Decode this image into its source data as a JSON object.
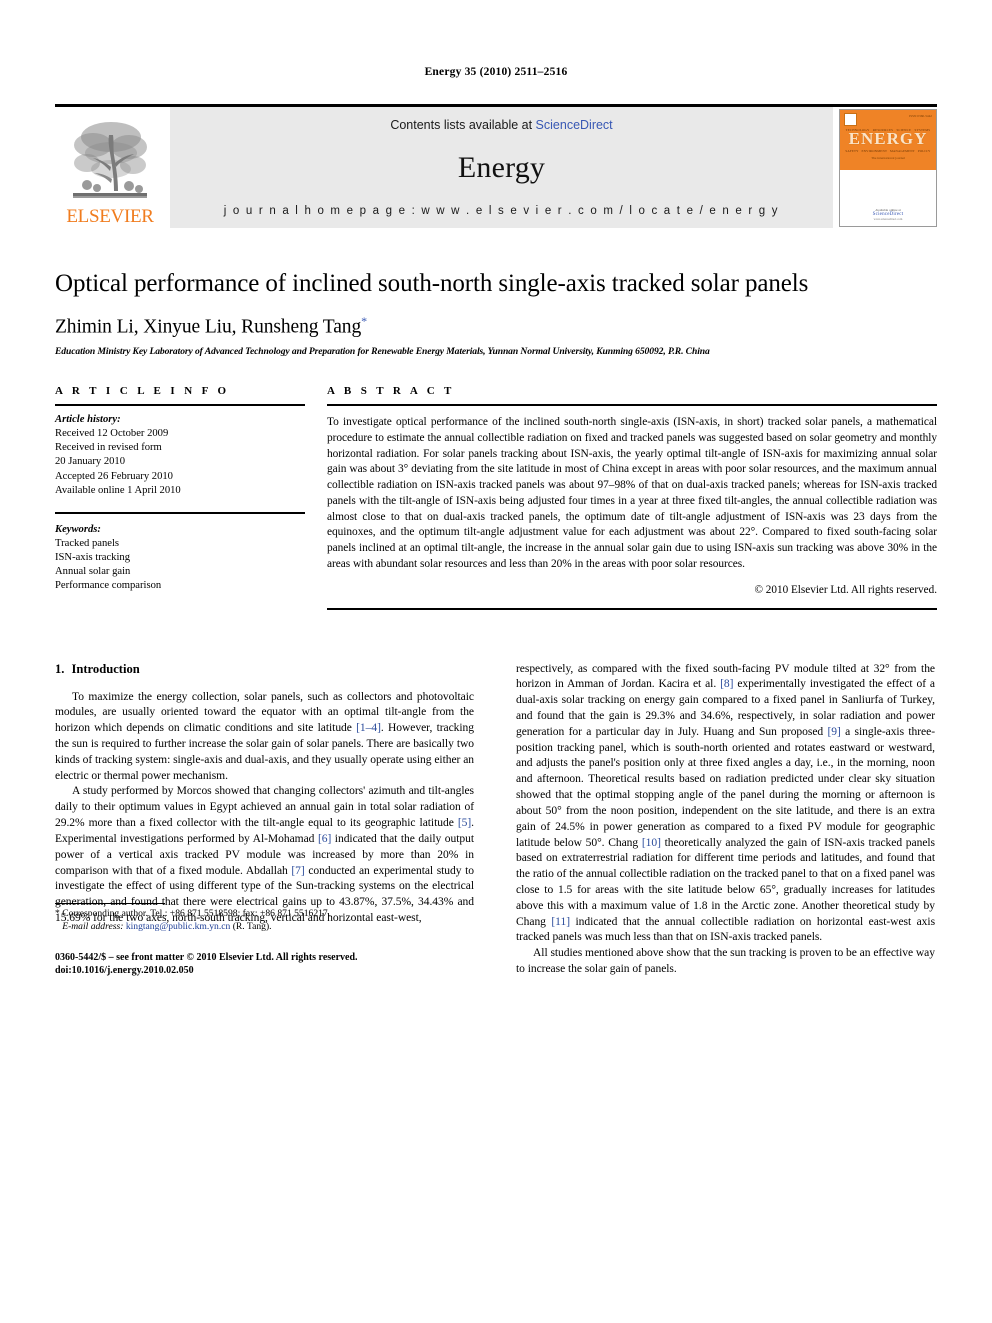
{
  "running_head": "Energy 35 (2010) 2511–2516",
  "masthead": {
    "publisher_name": "ELSEVIER",
    "contents_prefix": "Contents lists available at ",
    "contents_link": "ScienceDirect",
    "journal_title": "Energy",
    "homepage": "j o u r n a l   h o m e p a g e :   w w w . e l s e v i e r . c o m / l o c a t e / e n e r g y",
    "cover": {
      "title": "ENERGY",
      "tagline": "The international journal",
      "issn_code": "ISSN 0360-5442",
      "topics_row1": [
        "TECHNOLOGY",
        "RESOURCES",
        "SCIENCE",
        "SYSTEMS"
      ],
      "topics_row2": [
        "SAFETY",
        "ENVIRONMENT",
        "MANAGEMENT",
        "POLICY"
      ],
      "available_at": "Available online at",
      "sciencedirect": "ScienceDirect",
      "sd_url": "www.sciencedirect.com"
    }
  },
  "article": {
    "title": "Optical performance of inclined south-north single-axis tracked solar panels",
    "authors": "Zhimin Li, Xinyue Liu, Runsheng Tang",
    "corresponding_marker": "*",
    "affiliation": "Education Ministry Key Laboratory of Advanced Technology and Preparation for Renewable Energy Materials, Yunnan Normal University, Kunming 650092, P.R. China"
  },
  "article_info": {
    "heading": "A R T I C L E   I N F O",
    "history_label": "Article history:",
    "history": [
      "Received 12 October 2009",
      "Received in revised form",
      "20 January 2010",
      "Accepted 26 February 2010",
      "Available online 1 April 2010"
    ],
    "keywords_label": "Keywords:",
    "keywords": [
      "Tracked panels",
      "ISN-axis tracking",
      "Annual solar gain",
      "Performance comparison"
    ]
  },
  "abstract": {
    "heading": "A B S T R A C T",
    "text": "To investigate optical performance of the inclined south-north single-axis (ISN-axis, in short) tracked solar panels, a mathematical procedure to estimate the annual collectible radiation on fixed and tracked panels was suggested based on solar geometry and monthly horizontal radiation. For solar panels tracking about ISN-axis, the yearly optimal tilt-angle of ISN-axis for maximizing annual solar gain was about 3° deviating from the site latitude in most of China except in areas with poor solar resources, and the maximum annual collectible radiation on ISN-axis tracked panels was about 97–98% of that on dual-axis tracked panels; whereas for ISN-axis tracked panels with the tilt-angle of ISN-axis being adjusted four times in a year at three fixed tilt-angles, the annual collectible radiation was almost close to that on dual-axis tracked panels, the optimum date of tilt-angle adjustment of ISN-axis was 23 days from the equinoxes, and the optimum tilt-angle adjustment value for each adjustment was about 22°. Compared to fixed south-facing solar panels inclined at an optimal tilt-angle, the increase in the annual solar gain due to using ISN-axis sun tracking was above 30% in the areas with abundant solar resources and less than 20% in the areas with poor solar resources.",
    "copyright": "© 2010 Elsevier Ltd. All rights reserved."
  },
  "introduction": {
    "number": "1.",
    "heading": "Introduction",
    "left_paragraphs": [
      {
        "parts": [
          {
            "t": "To maximize the energy collection, solar panels, such as collectors and photovoltaic modules, are usually oriented toward the equator with an optimal tilt-angle from the horizon which depends on climatic conditions and site latitude "
          },
          {
            "t": "[1–4]",
            "cite": true
          },
          {
            "t": ". However, tracking the sun is required to further increase the solar gain of solar panels. There are basically two kinds of tracking system: single-axis and dual-axis, and they usually operate using either an electric or thermal power mechanism."
          }
        ]
      },
      {
        "parts": [
          {
            "t": "A study performed by Morcos showed that changing collectors' azimuth and tilt-angles daily to their optimum values in Egypt achieved an annual gain in total solar radiation of 29.2% more than a fixed collector with the tilt-angle equal to its geographic latitude "
          },
          {
            "t": "[5]",
            "cite": true
          },
          {
            "t": ". Experimental investigations performed by Al-Mohamad "
          },
          {
            "t": "[6]",
            "cite": true
          },
          {
            "t": " indicated that the daily output power of a vertical axis tracked PV module was increased by more than 20% in comparison with that of a fixed module. Abdallah "
          },
          {
            "t": "[7]",
            "cite": true
          },
          {
            "t": " conducted an experimental study to investigate the effect of using different type of the Sun-tracking systems on the electrical generation, and found that there were electrical gains up to 43.87%, 37.5%, 34.43% and 15.69% for the two axes, north-south tracking, vertical and horizontal east-west,"
          }
        ]
      }
    ],
    "right_paragraphs": [
      {
        "parts": [
          {
            "t": "respectively, as compared with the fixed south-facing PV module tilted at 32° from the horizon in Amman of Jordan. Kacira et al. "
          },
          {
            "t": "[8]",
            "cite": true
          },
          {
            "t": " experimentally investigated the effect of a dual-axis solar tracking on energy gain compared to a fixed panel in Sanliurfa of Turkey, and found that the gain is 29.3% and 34.6%, respectively, in solar radiation and power generation for a particular day in July. Huang and Sun proposed "
          },
          {
            "t": "[9]",
            "cite": true
          },
          {
            "t": " a single-axis three-position tracking panel, which is south-north oriented and rotates eastward or westward, and adjusts the panel's position only at three fixed angles a day, i.e., in the morning, noon and afternoon. Theoretical results based on radiation predicted under clear sky situation showed that the optimal stopping angle of the panel during the morning or afternoon is about 50° from the noon position, independent on the site latitude, and there is an extra gain of 24.5% in power generation as compared to a fixed PV module for geographic latitude below 50°. Chang "
          },
          {
            "t": "[10]",
            "cite": true
          },
          {
            "t": " theoretically analyzed the gain of ISN-axis tracked panels based on extraterrestrial radiation for different time periods and latitudes, and found that the ratio of the annual collectible radiation on the tracked panel to that on a fixed panel was close to 1.5 for areas with the site latitude below 65°, gradually increases for latitudes above this with a maximum value of 1.8 in the Arctic zone. Another theoretical study by Chang "
          },
          {
            "t": "[11]",
            "cite": true
          },
          {
            "t": " indicated that the annual collectible radiation on horizontal east-west axis tracked panels was much less than that on ISN-axis tracked panels."
          }
        ]
      },
      {
        "parts": [
          {
            "t": "All studies mentioned above show that the sun tracking is proven to be an effective way to increase the solar gain of panels."
          }
        ]
      }
    ]
  },
  "footnotes": {
    "corresponding": "* Corresponding author. Tel.: +86 871 5518598; fax: +86 871 5516217.",
    "email_label": "E-mail address:",
    "email": "kingtang@public.km.yn.cn",
    "email_suffix": " (R. Tang).",
    "issn_line": "0360-5442/$ – see front matter © 2010 Elsevier Ltd. All rights reserved.",
    "doi_line": "doi:10.1016/j.energy.2010.02.050"
  },
  "colors": {
    "elsevier_orange": "#f07c1e",
    "link_blue": "#3858b4",
    "citation_blue": "#2a4b9b",
    "banner_gray": "#e9e9e9"
  }
}
